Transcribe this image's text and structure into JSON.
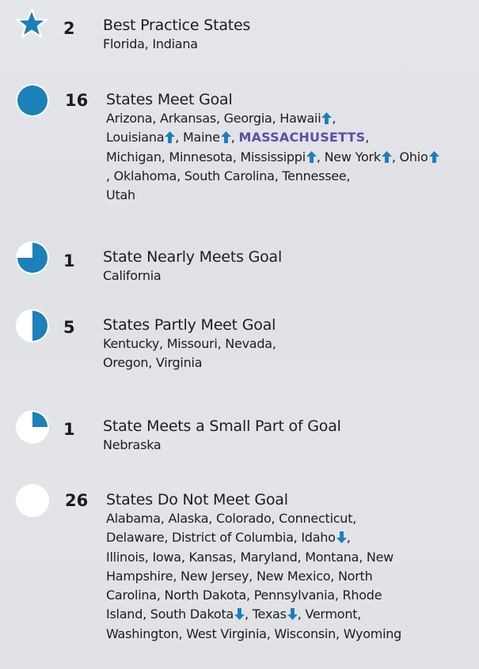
{
  "colors": {
    "accent": "#1c80b9",
    "highlight": "#5b4fa8",
    "text": "#1d1d1d"
  },
  "groups": [
    {
      "icon": "star-icon",
      "fill": "full",
      "count": "2",
      "heading": "Best Practice States",
      "states": [
        {
          "name": "Florida, Indiana"
        }
      ]
    },
    {
      "icon": "full-circle-icon",
      "fill": 1.0,
      "count": "16",
      "heading": "States Meet Goal",
      "states": [
        {
          "name": "Arizona, Arkansas, Georgia, Hawaii",
          "arrow": "up"
        },
        {
          "name": ","
        },
        {
          "name": "Louisiana",
          "arrow": "up"
        },
        {
          "name": ", Maine",
          "arrow": "up"
        },
        {
          "name": ","
        },
        {
          "name": "MASSACHUSETTS",
          "highlight": true
        },
        {
          "name": ","
        },
        {
          "name": "Michigan, Minnesota, Mississippi",
          "arrow": "up"
        },
        {
          "name": ", New York",
          "arrow": "up"
        },
        {
          "name": ","
        },
        {
          "name": "Ohio",
          "arrow": "up"
        },
        {
          "name": ", Oklahoma, South Carolina, Tennessee,"
        },
        {
          "name": "Utah"
        }
      ]
    },
    {
      "icon": "three-quarter-circle-icon",
      "fill": 0.75,
      "count": "1",
      "heading": "State Nearly Meets Goal",
      "states": [
        {
          "name": "California"
        }
      ]
    },
    {
      "icon": "half-circle-icon",
      "fill": 0.5,
      "count": "5",
      "heading": "States Partly Meet Goal",
      "states": [
        {
          "name": "Kentucky, Missouri, Nevada,"
        },
        {
          "name": "Oregon, Virginia"
        }
      ]
    },
    {
      "icon": "quarter-circle-icon",
      "fill": 0.25,
      "count": "1",
      "heading": "State Meets a Small Part of Goal",
      "states": [
        {
          "name": "Nebraska"
        }
      ]
    },
    {
      "icon": "empty-circle-icon",
      "fill": 0,
      "count": "26",
      "heading": "States Do Not Meet Goal",
      "states": [
        {
          "name": "Alabama, Alaska, Colorado, Connecticut,"
        },
        {
          "name": "Delaware, District of Columbia, Idaho",
          "arrow": "down"
        },
        {
          "name": ","
        },
        {
          "name": "Illinois, Iowa, Kansas, Maryland, Montana, New"
        },
        {
          "name": "Hampshire, New Jersey, New Mexico, North"
        },
        {
          "name": "Carolina, North Dakota, Pennsylvania, Rhode"
        },
        {
          "name": "Island, South Dakota",
          "arrow": "down"
        },
        {
          "name": ", Texas",
          "arrow": "down"
        },
        {
          "name": ", Vermont,"
        },
        {
          "name": "Washington, West Virginia, Wisconsin, Wyoming"
        }
      ]
    }
  ]
}
